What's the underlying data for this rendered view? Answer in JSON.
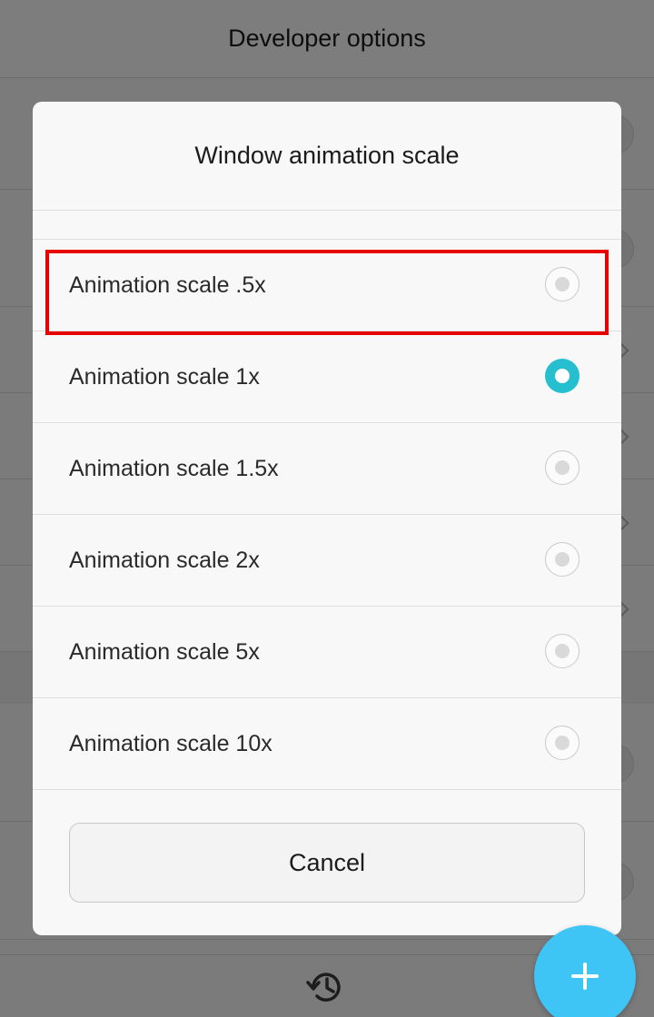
{
  "header": {
    "title": "Developer options"
  },
  "dialog": {
    "title": "Window animation scale",
    "options": [
      {
        "label": "Animation scale .5x",
        "selected": false
      },
      {
        "label": "Animation scale 1x",
        "selected": true
      },
      {
        "label": "Animation scale 1.5x",
        "selected": false
      },
      {
        "label": "Animation scale 2x",
        "selected": false
      },
      {
        "label": "Animation scale 5x",
        "selected": false
      },
      {
        "label": "Animation scale 10x",
        "selected": false
      }
    ],
    "cancel_label": "Cancel"
  },
  "colors": {
    "accent": "#26bfcf",
    "fab": "#3ec5f5",
    "highlight": "#e60000"
  },
  "icons": {
    "bottom_bar": "history-icon",
    "fab": "plus-icon"
  }
}
